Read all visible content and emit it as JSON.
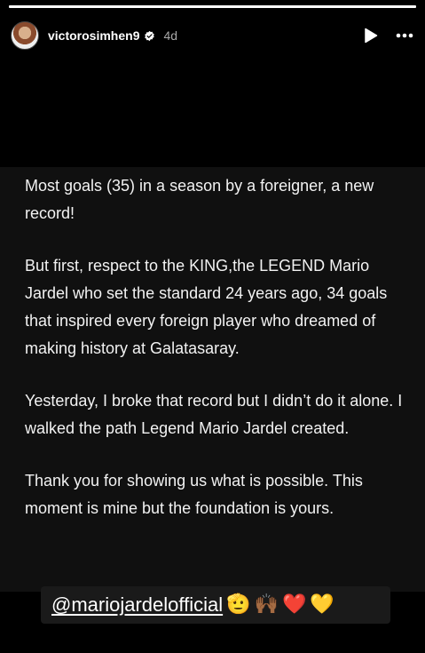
{
  "story": {
    "segments": 1,
    "username": "victorosimhen9",
    "time": "4d",
    "icons": {
      "avatar": "profile-avatar",
      "verified": "verified-badge-icon",
      "play": "play-icon",
      "more": "more-options-icon"
    }
  },
  "post": {
    "paragraphs": [
      "Most goals (35) in a season by a foreigner, a new record!",
      "But first, respect to the KING,the LEGEND Mario Jardel who set the standard 24 years ago, 34 goals that inspired every foreign player who dreamed of making history at Galatasaray.",
      "Yesterday, I broke that record but I didn’t do it alone. I walked the path Legend Mario Jardel created.",
      "Thank you for showing us what is possible. This moment is mine but the foundation is yours."
    ],
    "mention": "@mariojardelofficial",
    "emojis": [
      "🫡",
      "🙌🏾",
      "❤️",
      "💛"
    ]
  },
  "colors": {
    "background": "#000000",
    "text_box": "#101010",
    "text": "#f2f2f2",
    "muted": "#a8a8a8",
    "verified": "#ffffff"
  }
}
